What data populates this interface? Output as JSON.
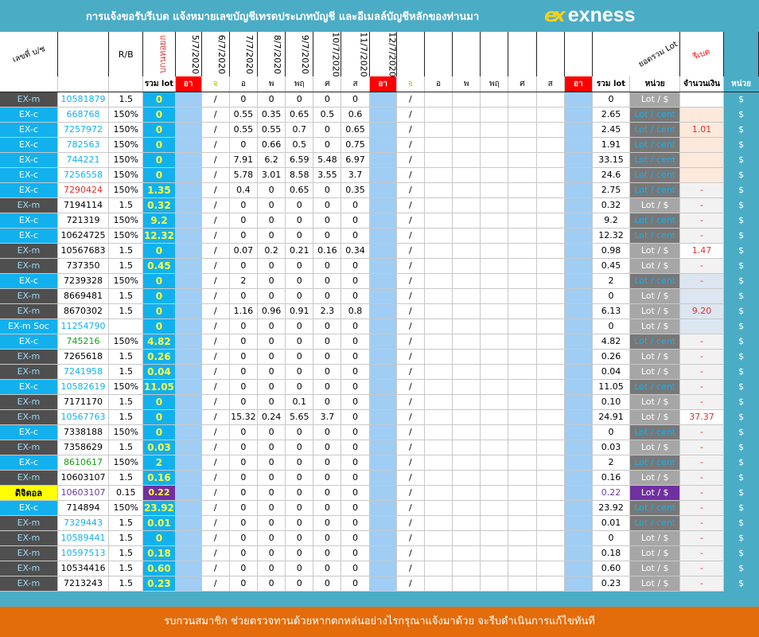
{
  "header": {
    "title": "การแจ้งขอรับรีเบต   แจ้งหมายเลขบัญชีเทรดประเภทบัญชี และอีเมลล์บัญชีหลักของท่านมา",
    "logo_text": "exness",
    "logo_mark": "ex"
  },
  "columns": {
    "account": "เลขที่ บ/ช",
    "rb": "R/B",
    "lot_col": "บกนทอยก",
    "dates": [
      "5/7/2020",
      "6/7/2020",
      "7/7/2020",
      "8/7/2020",
      "9/7/2020",
      "10/7/2020",
      "11/7/2020",
      "12/7/2020"
    ],
    "total_lot_header": "ยอดรวม Lot",
    "rebate_header": "รีเบต",
    "sub": {
      "total_lot": "รวม lot",
      "day0": "อา",
      "day1": "จ",
      "day2": "อ",
      "day3": "พ",
      "day4": "พฤ",
      "day5": "ศ",
      "day6": "ส",
      "day7": "อา",
      "w2d1": "จ",
      "w2d2": "อ",
      "w2d3": "พ",
      "w2d4": "พฤ",
      "w2d5": "ศ",
      "w2d6": "ส",
      "w2d7": "อา",
      "sum_lot": "รวม lot",
      "unit": "หน่วย",
      "amount": "จำนวนเงิน",
      "unit2": "หน่วย"
    }
  },
  "rows": [
    {
      "type": "EX-m",
      "acct": "10581879",
      "rb": "1.5",
      "lot": "0",
      "w": [
        "",
        "0",
        "0",
        "0",
        "0",
        "0"
      ],
      "sum": "0",
      "unit": "Lot / $",
      "amt": "",
      "cur": "$"
    },
    {
      "type": "EX-c",
      "acct": "668768",
      "rb": "150%",
      "lot": "0",
      "w": [
        "",
        "0.55",
        "0.35",
        "0.65",
        "0.5",
        "0.6"
      ],
      "sum": "2.65",
      "unit": "Lot / cent",
      "amt": "",
      "cur": "$"
    },
    {
      "type": "EX-c",
      "acct": "7257972",
      "rb": "150%",
      "lot": "0",
      "w": [
        "",
        "0.55",
        "0.55",
        "0.7",
        "0",
        "0.65"
      ],
      "sum": "2.45",
      "unit": "Lot / cent",
      "amt": "1.01",
      "cur": "$"
    },
    {
      "type": "EX-c",
      "acct": "782563",
      "rb": "150%",
      "lot": "0",
      "w": [
        "",
        "0",
        "0.66",
        "0.5",
        "0",
        "0.75"
      ],
      "sum": "1.91",
      "unit": "Lot / cent",
      "amt": "",
      "cur": "$"
    },
    {
      "type": "EX-c",
      "acct": "744221",
      "rb": "150%",
      "lot": "0",
      "w": [
        "",
        "7.91",
        "6.2",
        "6.59",
        "5.48",
        "6.97"
      ],
      "sum": "33.15",
      "unit": "Lot / cent",
      "amt": "",
      "cur": "$"
    },
    {
      "type": "EX-c",
      "acct": "7256558",
      "rb": "150%",
      "lot": "0",
      "w": [
        "",
        "5.78",
        "3.01",
        "8.58",
        "3.55",
        "3.7"
      ],
      "sum": "24.6",
      "unit": "Lot / cent",
      "amt": "",
      "cur": "$"
    },
    {
      "type": "EX-c",
      "acct": "7290424",
      "rb": "150%",
      "lot": "1.35",
      "w": [
        "",
        "0.4",
        "0",
        "0.65",
        "0",
        "0.35"
      ],
      "sum": "2.75",
      "unit": "Lot / cent",
      "amt": "-",
      "cur": "$"
    },
    {
      "type": "EX-m",
      "acct": "7194114",
      "rb": "1.5",
      "lot": "0.32",
      "w": [
        "",
        "0",
        "0",
        "0",
        "0",
        "0"
      ],
      "sum": "0.32",
      "unit": "Lot / $",
      "amt": "-",
      "cur": "$"
    },
    {
      "type": "EX-c",
      "acct": "721319",
      "rb": "150%",
      "lot": "9.2",
      "w": [
        "",
        "0",
        "0",
        "0",
        "0",
        "0"
      ],
      "sum": "9.2",
      "unit": "Lot / cent",
      "amt": "-",
      "cur": "$"
    },
    {
      "type": "EX-c",
      "acct": "10624725",
      "rb": "150%",
      "lot": "12.32",
      "w": [
        "",
        "0",
        "0",
        "0",
        "0",
        "0"
      ],
      "sum": "12.32",
      "unit": "Lot / cent",
      "amt": "-",
      "cur": "$"
    },
    {
      "type": "EX-m",
      "acct": "10567683",
      "rb": "1.5",
      "lot": "0",
      "w": [
        "",
        "0.07",
        "0.2",
        "0.21",
        "0.16",
        "0.34"
      ],
      "sum": "0.98",
      "unit": "Lot / $",
      "amt": "1.47",
      "cur": "$"
    },
    {
      "type": "EX-m",
      "acct": "737350",
      "rb": "1.5",
      "lot": "0.45",
      "w": [
        "",
        "0",
        "0",
        "0",
        "0",
        "0"
      ],
      "sum": "0.45",
      "unit": "Lot / $",
      "amt": "-",
      "cur": "$"
    },
    {
      "type": "EX-c",
      "acct": "7239328",
      "rb": "150%",
      "lot": "0",
      "w": [
        "",
        "2",
        "0",
        "0",
        "0",
        "0"
      ],
      "sum": "2",
      "unit": "Lot / cent",
      "amt": "-",
      "cur": "$"
    },
    {
      "type": "EX-m",
      "acct": "8669481",
      "rb": "1.5",
      "lot": "0",
      "w": [
        "",
        "0",
        "0",
        "0",
        "0",
        "0"
      ],
      "sum": "0",
      "unit": "Lot / $",
      "amt": "",
      "cur": "$"
    },
    {
      "type": "EX-m",
      "acct": "8670302",
      "rb": "1.5",
      "lot": "0",
      "w": [
        "",
        "1.16",
        "0.96",
        "0.91",
        "2.3",
        "0.8"
      ],
      "sum": "6.13",
      "unit": "Lot / $",
      "amt": "9.20",
      "cur": "$"
    },
    {
      "type": "EX-m Soc",
      "acct": "11254790",
      "rb": "",
      "lot": "0",
      "w": [
        "",
        "0",
        "0",
        "0",
        "0",
        "0"
      ],
      "sum": "0",
      "unit": "Lot / $",
      "amt": "",
      "cur": "$"
    },
    {
      "type": "EX-c",
      "acct": "745216",
      "rb": "150%",
      "lot": "4.82",
      "w": [
        "",
        "0",
        "0",
        "0",
        "0",
        "0"
      ],
      "sum": "4.82",
      "unit": "Lot / cent",
      "amt": "-",
      "cur": "$"
    },
    {
      "type": "EX-m",
      "acct": "7265618",
      "rb": "1.5",
      "lot": "0.26",
      "w": [
        "",
        "0",
        "0",
        "0",
        "0",
        "0"
      ],
      "sum": "0.26",
      "unit": "Lot / $",
      "amt": "-",
      "cur": "$"
    },
    {
      "type": "EX-m",
      "acct": "7241958",
      "rb": "1.5",
      "lot": "0.04",
      "w": [
        "",
        "0",
        "0",
        "0",
        "0",
        "0"
      ],
      "sum": "0.04",
      "unit": "Lot / $",
      "amt": "-",
      "cur": "$"
    },
    {
      "type": "EX-c",
      "acct": "10582619",
      "rb": "150%",
      "lot": "11.05",
      "w": [
        "",
        "0",
        "0",
        "0",
        "0",
        "0"
      ],
      "sum": "11.05",
      "unit": "Lot / cent",
      "amt": "-",
      "cur": "$"
    },
    {
      "type": "EX-m",
      "acct": "7171170",
      "rb": "1.5",
      "lot": "0",
      "w": [
        "",
        "0",
        "0",
        "0.1",
        "0",
        "0"
      ],
      "sum": "0.10",
      "unit": "Lot / $",
      "amt": "-",
      "cur": "$"
    },
    {
      "type": "EX-m",
      "acct": "10567763",
      "rb": "1.5",
      "lot": "0",
      "w": [
        "",
        "15.32",
        "0.24",
        "5.65",
        "3.7",
        "0"
      ],
      "sum": "24.91",
      "unit": "Lot / $",
      "amt": "37.37",
      "cur": "$"
    },
    {
      "type": "EX-c",
      "acct": "7338188",
      "rb": "150%",
      "lot": "0",
      "w": [
        "",
        "0",
        "0",
        "0",
        "0",
        "0"
      ],
      "sum": "0",
      "unit": "Lot / cent",
      "amt": "-",
      "cur": "$"
    },
    {
      "type": "EX-m",
      "acct": "7358629",
      "rb": "1.5",
      "lot": "0.03",
      "w": [
        "",
        "0",
        "0",
        "0",
        "0",
        "0"
      ],
      "sum": "0.03",
      "unit": "Lot / $",
      "amt": "-",
      "cur": "$"
    },
    {
      "type": "EX-c",
      "acct": "8610617",
      "rb": "150%",
      "lot": "2",
      "w": [
        "",
        "0",
        "0",
        "0",
        "0",
        "0"
      ],
      "sum": "2",
      "unit": "Lot / cent",
      "amt": "-",
      "cur": "$"
    },
    {
      "type": "EX-m",
      "acct": "10603107",
      "rb": "1.5",
      "lot": "0.16",
      "w": [
        "",
        "0",
        "0",
        "0",
        "0",
        "0"
      ],
      "sum": "0.16",
      "unit": "Lot / $",
      "amt": "-",
      "cur": "$"
    },
    {
      "type": "ดิจิตอล",
      "acct": "10603107",
      "rb": "0.15",
      "lot": "0.22",
      "w": [
        "",
        "0",
        "0",
        "0",
        "0",
        "0"
      ],
      "sum": "0.22",
      "unit": "Lot / $",
      "amt": "-",
      "cur": "$"
    },
    {
      "type": "EX-c",
      "acct": "714894",
      "rb": "150%",
      "lot": "23.92",
      "w": [
        "",
        "0",
        "0",
        "0",
        "0",
        "0"
      ],
      "sum": "23.92",
      "unit": "Lot / cent",
      "amt": "-",
      "cur": "$"
    },
    {
      "type": "EX-m",
      "acct": "7329443",
      "rb": "1.5",
      "lot": "0.01",
      "w": [
        "",
        "0",
        "0",
        "0",
        "0",
        "0"
      ],
      "sum": "0.01",
      "unit": "Lot / cent",
      "amt": "-",
      "cur": "$"
    },
    {
      "type": "EX-m",
      "acct": "10589441",
      "rb": "1.5",
      "lot": "0",
      "w": [
        "",
        "0",
        "0",
        "0",
        "0",
        "0"
      ],
      "sum": "0",
      "unit": "Lot / $",
      "amt": "-",
      "cur": "$"
    },
    {
      "type": "EX-m",
      "acct": "10597513",
      "rb": "1.5",
      "lot": "0.18",
      "w": [
        "",
        "0",
        "0",
        "0",
        "0",
        "0"
      ],
      "sum": "0.18",
      "unit": "Lot / $",
      "amt": "-",
      "cur": "$"
    },
    {
      "type": "EX-m",
      "acct": "10534416",
      "rb": "1.5",
      "lot": "0.60",
      "w": [
        "",
        "0",
        "0",
        "0",
        "0",
        "0"
      ],
      "sum": "0.60",
      "unit": "Lot / $",
      "amt": "-",
      "cur": "$"
    },
    {
      "type": "EX-m",
      "acct": "7213243",
      "rb": "1.5",
      "lot": "0.23",
      "w": [
        "",
        "0",
        "0",
        "0",
        "0",
        "0"
      ],
      "sum": "0.23",
      "unit": "Lot / $",
      "amt": "-",
      "cur": "$"
    }
  ],
  "slash": "/",
  "footer": {
    "text": "รบกวนสมาชิก ช่วยตรวจทานด้วยหากตกหล่นอย่างไรกรุณาแจ้งมาด้วย จะรีบดำเนินการแก้ไขทันที"
  },
  "colors": {
    "header_blue": "#4bacc6",
    "footer_orange": "#e46c0a",
    "cyan": "#12b1ee",
    "dark": "#4f4f4f",
    "red": "#ff0000",
    "purple": "#7030a0"
  }
}
